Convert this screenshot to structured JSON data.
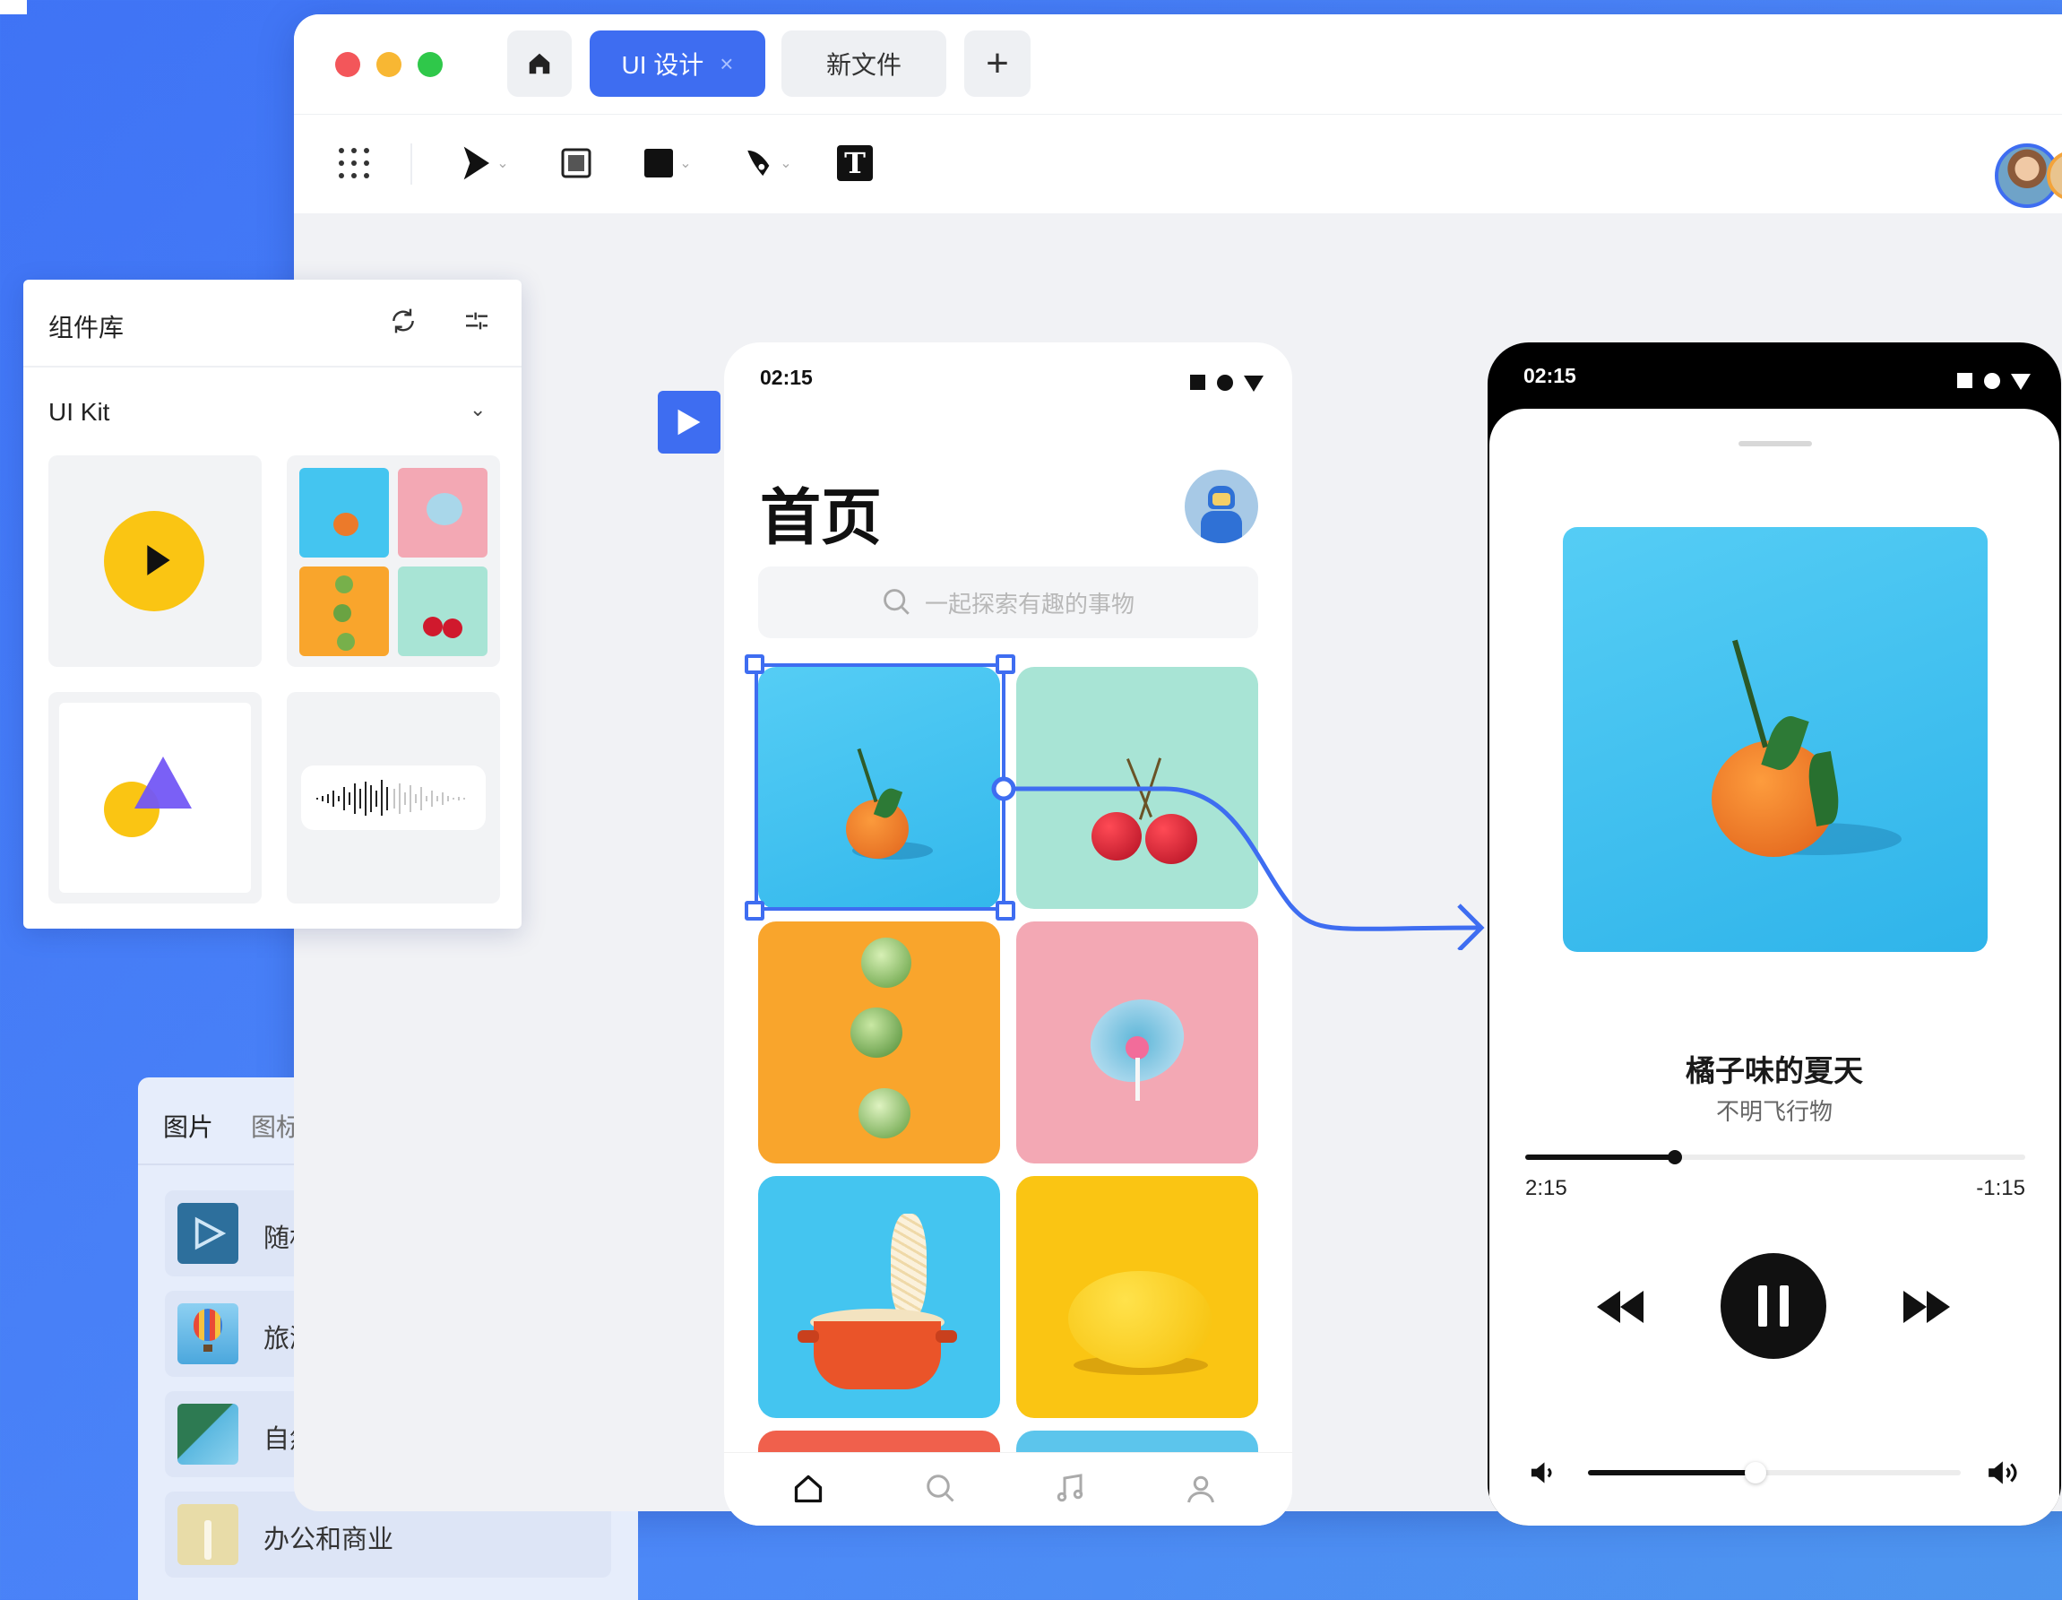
{
  "window": {
    "tabs": [
      {
        "label": "UI 设计",
        "close": "×",
        "active": true
      },
      {
        "label": "新文件",
        "active": false
      }
    ],
    "add_tab": "+",
    "toolbar_icons": [
      "grid-icon",
      "pointer-icon",
      "frame-icon",
      "rectangle-icon",
      "pen-icon",
      "text-icon"
    ],
    "text_tool_glyph": "T"
  },
  "components_panel": {
    "title": "组件库",
    "kit_name": "UI Kit"
  },
  "assets_panel": {
    "tabs": [
      "图片",
      "图标"
    ],
    "items": [
      {
        "label": "随机",
        "icon": "play-icon"
      },
      {
        "label": "旅游",
        "icon": "balloon-icon"
      },
      {
        "label": "自然",
        "icon": "nature-icon"
      },
      {
        "label": "办公和商业",
        "icon": "office-icon"
      }
    ]
  },
  "phone_home": {
    "time": "02:15",
    "title": "首页",
    "search_placeholder": "一起探索有趣的事物",
    "tiles": [
      "orange",
      "cherries",
      "brussels-sprouts",
      "lollipop",
      "noodles-pot",
      "lemon"
    ],
    "nav": [
      "home-icon",
      "search-icon",
      "music-icon",
      "profile-icon"
    ]
  },
  "phone_player": {
    "time": "02:15",
    "song_title": "橘子味的夏天",
    "artist": "不明飞行物",
    "elapsed": "2:15",
    "remaining": "-1:15",
    "progress": 0.3,
    "volume": 0.45
  },
  "colors": {
    "accent": "#3e6df1",
    "background": "#4a82f7",
    "yellow": "#fac513",
    "orange_tile": "#f9a52c",
    "pink_tile": "#f3a8b4",
    "blue_tile": "#44c5f0",
    "mint_tile": "#a8e4d5"
  }
}
